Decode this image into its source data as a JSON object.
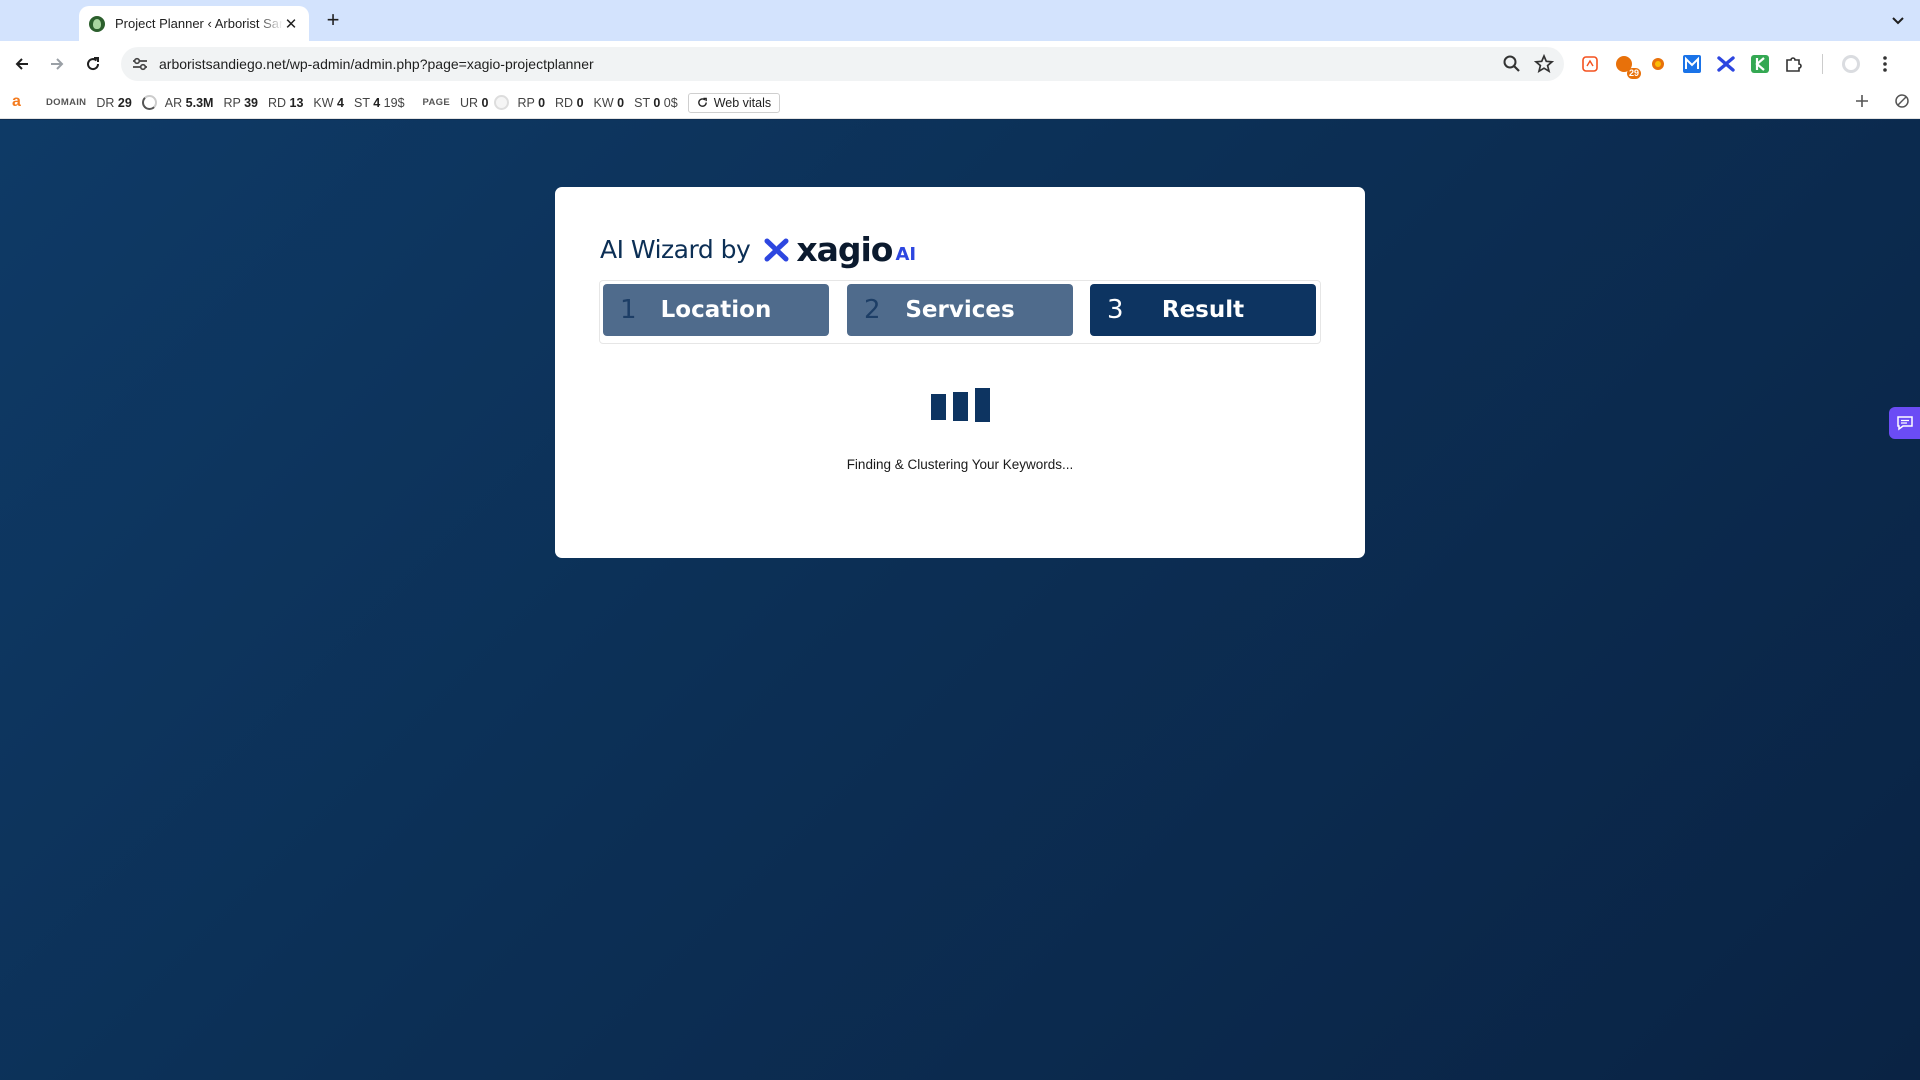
{
  "browser": {
    "tab_title": "Project Planner ‹ Arborist San Diego — WordPress",
    "tab_close": "✕",
    "new_tab": "+",
    "url": "arboristsandiego.net/wp-admin/admin.php?page=xagio-projectplanner",
    "extensions": [
      {
        "name": "rating-extension-icon",
        "color": "#f4511e"
      },
      {
        "name": "cookie-extension-icon",
        "color": "#e8710a",
        "badge": "29"
      },
      {
        "name": "bug-extension-icon",
        "color": "#e8710a"
      },
      {
        "name": "m-extension-icon",
        "color": "#1a73e8"
      },
      {
        "name": "xagio-extension-icon",
        "color": "#2d46e0"
      },
      {
        "name": "k-extension-icon",
        "color": "#34a853"
      },
      {
        "name": "puzzle-extension-icon",
        "color": "#5f6368"
      }
    ]
  },
  "seobar": {
    "domain_caption": "DOMAIN",
    "dr_label": "DR",
    "dr_value": "29",
    "ar_label": "AR",
    "ar_value": "5.3M",
    "rp_label": "RP",
    "rp_value": "39",
    "rd_label": "RD",
    "rd_value": "13",
    "kw_label": "KW",
    "kw_value": "4",
    "st_label": "ST",
    "st_value": "4",
    "st_cost": "19$",
    "page_caption": "PAGE",
    "ur_label": "UR",
    "ur_value": "0",
    "p_rp_label": "RP",
    "p_rp_value": "0",
    "p_rd_label": "RD",
    "p_rd_value": "0",
    "p_kw_label": "KW",
    "p_kw_value": "0",
    "p_st_label": "ST",
    "p_st_value": "0",
    "p_st_cost": "0$",
    "web_vitals": "Web vitals"
  },
  "wizard": {
    "title": "AI Wizard by",
    "brand_word": "xagio",
    "brand_suffix": "AI",
    "steps": [
      {
        "num": "1",
        "label": "Location"
      },
      {
        "num": "2",
        "label": "Services"
      },
      {
        "num": "3",
        "label": "Result"
      }
    ],
    "active_step": 3,
    "loading_text": "Finding & Clustering Your Keywords..."
  },
  "colors": {
    "page_bg": "#0e2d52",
    "step_inactive": "#4f6b8c",
    "step_active": "#0d3461",
    "brand_accent": "#2d46e0",
    "side_tab": "#6b4cf5"
  }
}
